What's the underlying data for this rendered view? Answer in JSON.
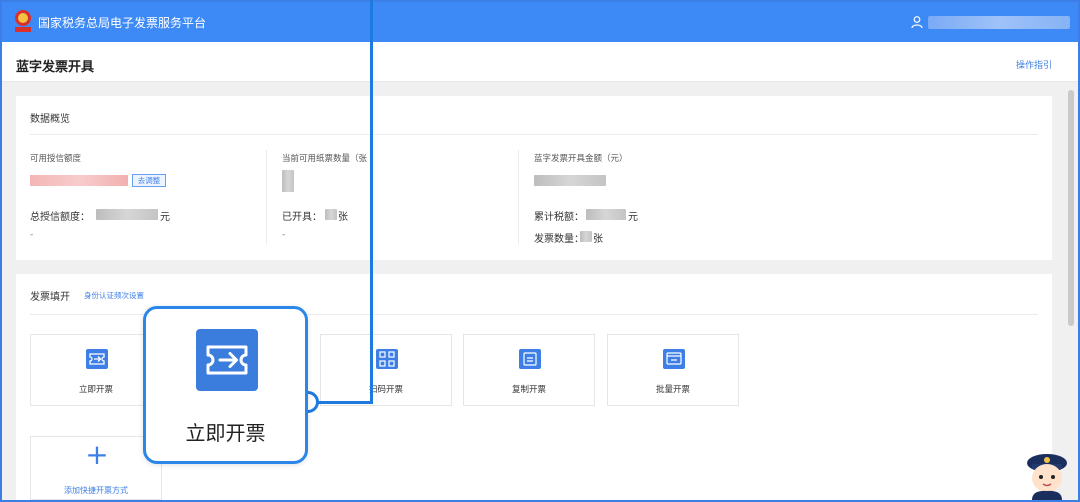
{
  "header": {
    "site_title": "国家税务总局电子发票服务平台",
    "user_icon": "user-icon",
    "emblem": "tax-emblem-icon"
  },
  "title_bar": {
    "page_title": "蓝字发票开具",
    "guide_link": "操作指引"
  },
  "overview": {
    "title": "数据概览",
    "credit": {
      "label": "可用授信额度",
      "adjust_label": "去调整",
      "total_label": "总授信额度：",
      "total_unit": "元",
      "dash": "-"
    },
    "paper": {
      "label": "当前可用纸票数量（张",
      "issued_label": "已开具：",
      "issued_unit": "张",
      "dash": "-"
    },
    "amount": {
      "label": "蓝字发票开具金额（元）",
      "tax_label": "累计税额：",
      "tax_unit": "元",
      "count_label": "发票数量：",
      "count_unit": "张"
    }
  },
  "fill": {
    "title": "发票填开",
    "identity_link": "身份认证频次设置",
    "tiles": [
      {
        "label": "立即开票",
        "icon": "ticket-arrow-icon"
      },
      {
        "label": "扫码开票",
        "icon": "qr-code-icon"
      },
      {
        "label": "复制开票",
        "icon": "copy-ticket-icon"
      },
      {
        "label": "批量开票",
        "icon": "batch-ticket-icon"
      }
    ],
    "add_label": "添加快捷开票方式"
  },
  "callout": {
    "label": "立即开票",
    "icon": "ticket-arrow-icon"
  },
  "colors": {
    "header_blue": "#3d8af7",
    "accent_blue": "#3d7fe6",
    "callout_blue": "#2b86ea"
  }
}
